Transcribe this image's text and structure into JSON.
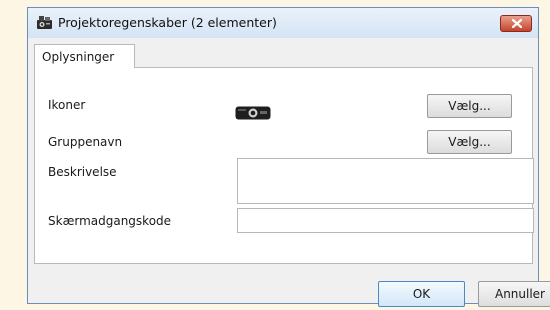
{
  "dialog": {
    "title": "Projektoregenskaber (2 elementer)",
    "tab_label": "Oplysninger"
  },
  "fields": {
    "icons_label": "Ikoner",
    "icons_button": "Vælg...",
    "groupname_label": "Gruppenavn",
    "groupname_button": "Vælg...",
    "description_label": "Beskrivelse",
    "description_value": "",
    "password_label": "Skærmadgangskode",
    "password_value": ""
  },
  "buttons": {
    "ok": "OK",
    "cancel": "Annuller"
  },
  "icons": {
    "title": "projector-group-icon",
    "selected": "projector-icon",
    "close": "close-icon"
  },
  "colors": {
    "close_button": "#c4442c",
    "default_button_border": "#4a8ac4"
  }
}
